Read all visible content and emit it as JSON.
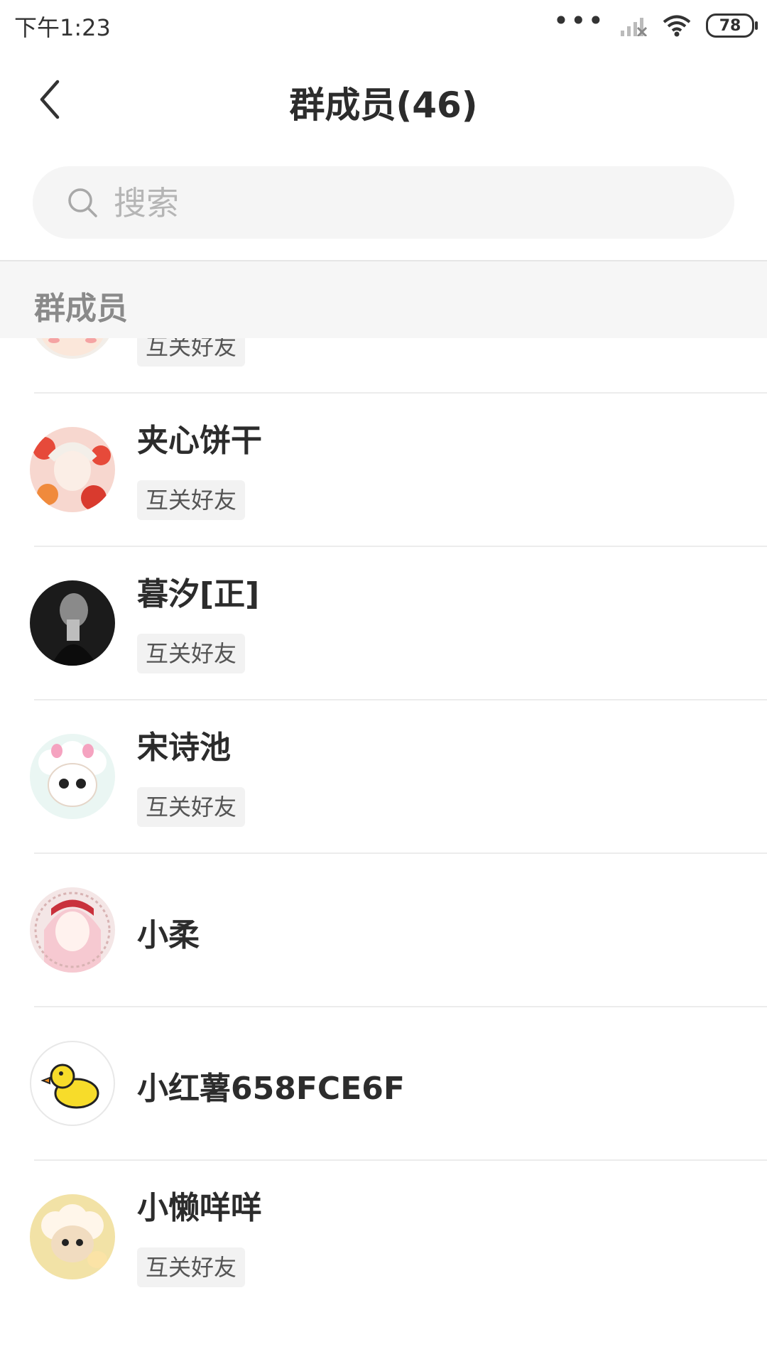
{
  "status": {
    "time": "下午1:23",
    "battery": "78"
  },
  "nav": {
    "title": "群成员(46)"
  },
  "search": {
    "placeholder": "搜索"
  },
  "section": {
    "label": "群成员"
  },
  "members": [
    {
      "name": "",
      "tag": "互关好友"
    },
    {
      "name": "夹心饼干",
      "tag": "互关好友"
    },
    {
      "name": "暮汐[正]",
      "tag": "互关好友"
    },
    {
      "name": "宋诗池",
      "tag": "互关好友"
    },
    {
      "name": "小柔",
      "tag": ""
    },
    {
      "name": "小红薯658FCE6F",
      "tag": ""
    },
    {
      "name": "小懒咩咩",
      "tag": "互关好友"
    }
  ]
}
